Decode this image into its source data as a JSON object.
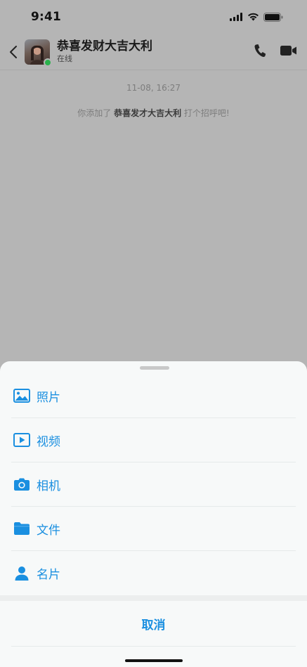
{
  "status_bar": {
    "time": "9:41",
    "icons": [
      "signal-icon",
      "wifi-icon",
      "battery-icon"
    ]
  },
  "header": {
    "back_icon": "chevron-left-icon",
    "contact_name": "恭喜发财大吉大利",
    "status": "在线",
    "actions": [
      "phone-icon",
      "video-camera-icon"
    ]
  },
  "chat": {
    "timestamp": "11-08, 16:27",
    "system_message": {
      "prefix": "你添加了 ",
      "name": "恭喜发才大吉大利",
      "suffix": " 打个招呼吧!"
    }
  },
  "sheet": {
    "items": [
      {
        "label": "照片",
        "icon": "photo-icon"
      },
      {
        "label": "视频",
        "icon": "video-icon"
      },
      {
        "label": "相机",
        "icon": "camera-icon"
      },
      {
        "label": "文件",
        "icon": "folder-icon"
      },
      {
        "label": "名片",
        "icon": "contact-card-icon"
      }
    ],
    "cancel_label": "取消"
  },
  "colors": {
    "accent": "#1a8fe0",
    "online": "#2bb24c",
    "overlay": "#b5b5b5",
    "sheet_bg": "#f7f9f9"
  }
}
